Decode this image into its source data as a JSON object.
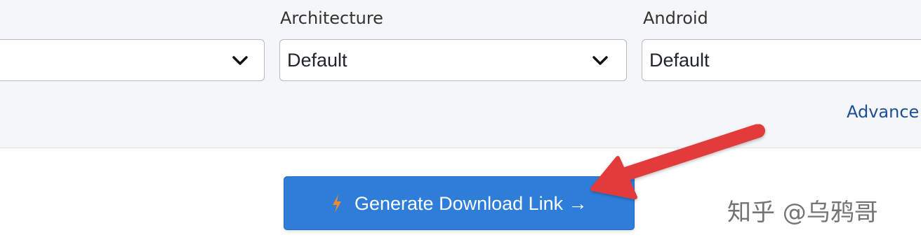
{
  "form": {
    "fields": [
      {
        "label": "",
        "value": ""
      },
      {
        "label": "Architecture",
        "value": "Default"
      },
      {
        "label": "Android",
        "value": "Default"
      }
    ],
    "advanced_link": "Advance"
  },
  "generate_button": {
    "label": "Generate Download Link →",
    "icon": "bolt-icon"
  },
  "annotation": {
    "icon": "red-pointer-arrow",
    "color": "#e33b3b"
  },
  "watermark": {
    "text": "知乎 @乌鸦哥"
  },
  "colors": {
    "accent": "#2e7ed9",
    "link": "#1f4f99",
    "bolt": "#f08a2c"
  }
}
